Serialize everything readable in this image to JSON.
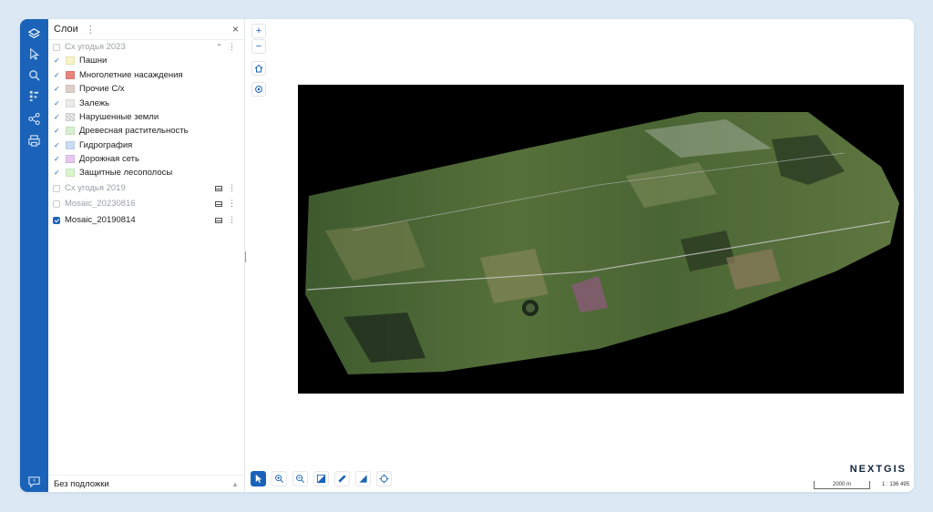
{
  "panel": {
    "title": "Слои",
    "menu_icon": "⋮",
    "close_icon": "×"
  },
  "layers": [
    {
      "label": "Сх угодья 2023",
      "group": true,
      "visible": false,
      "muted": true,
      "expanded": true
    },
    {
      "label": "Пашни",
      "checked": true,
      "swatch": "#f8f4c7"
    },
    {
      "label": "Многолетние насаждения",
      "checked": true,
      "swatch": "#e8837c"
    },
    {
      "label": "Прочие С/х",
      "checked": true,
      "swatch": "#ddd0c8"
    },
    {
      "label": "Залежь",
      "checked": true,
      "swatch": "#ecebea"
    },
    {
      "label": "Нарушенные земли",
      "checked": true,
      "swatch": "hatch"
    },
    {
      "label": "Древесная растительность",
      "checked": true,
      "swatch": "#d7f0cf"
    },
    {
      "label": "Гидрография",
      "checked": true,
      "swatch": "#c9dcf6"
    },
    {
      "label": "Дорожная сеть",
      "checked": true,
      "swatch": "#e7c6f0"
    },
    {
      "label": "Защитные лесополосы",
      "checked": true,
      "swatch": "#d8f5cc"
    },
    {
      "label": "Сх угодья 2019",
      "group": true,
      "visible": false,
      "muted": true
    },
    {
      "label": "Mosaic_20230816",
      "group": true,
      "visible": false,
      "muted": true
    },
    {
      "label": "Mosaic_20190814",
      "group": true,
      "visible": true,
      "muted": false
    }
  ],
  "basemap": {
    "label": "Без подложки"
  },
  "map_controls": {
    "zoom_in": "+",
    "zoom_out": "−"
  },
  "brand": "NEXTGIS",
  "scale": {
    "bar_label": "2000 m",
    "ratio": "1 : 136 495"
  },
  "colors": {
    "accent": "#1a63b8",
    "background": "#dce9f5"
  }
}
